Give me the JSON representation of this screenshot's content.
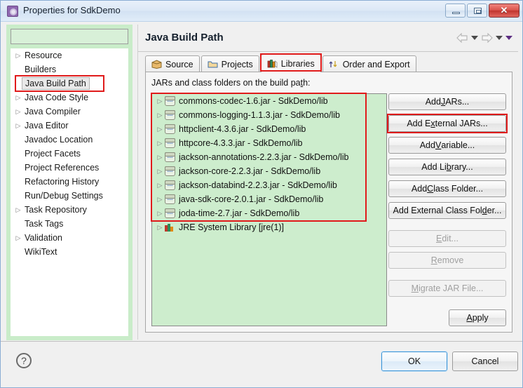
{
  "window": {
    "title": "Properties for SdkDemo",
    "icon": "properties-gear-icon",
    "controls": {
      "minimize": "–",
      "restore": "❐",
      "close": "✕"
    }
  },
  "sidebar": {
    "filter": {
      "value": "",
      "placeholder": ""
    },
    "items": [
      {
        "label": "Resource",
        "expandable": true,
        "selected": false
      },
      {
        "label": "Builders",
        "expandable": false,
        "selected": false
      },
      {
        "label": "Java Build Path",
        "expandable": false,
        "selected": true
      },
      {
        "label": "Java Code Style",
        "expandable": true,
        "selected": false
      },
      {
        "label": "Java Compiler",
        "expandable": true,
        "selected": false
      },
      {
        "label": "Java Editor",
        "expandable": true,
        "selected": false
      },
      {
        "label": "Javadoc Location",
        "expandable": false,
        "selected": false
      },
      {
        "label": "Project Facets",
        "expandable": false,
        "selected": false
      },
      {
        "label": "Project References",
        "expandable": false,
        "selected": false
      },
      {
        "label": "Refactoring History",
        "expandable": false,
        "selected": false
      },
      {
        "label": "Run/Debug Settings",
        "expandable": false,
        "selected": false
      },
      {
        "label": "Task Repository",
        "expandable": true,
        "selected": false
      },
      {
        "label": "Task Tags",
        "expandable": false,
        "selected": false
      },
      {
        "label": "Validation",
        "expandable": true,
        "selected": false
      },
      {
        "label": "WikiText",
        "expandable": false,
        "selected": false
      }
    ]
  },
  "main": {
    "page_title": "Java Build Path",
    "nav": {
      "back_icon": "back-arrow-icon",
      "back_dropdown_icon": "chevron-down-icon",
      "forward_icon": "forward-arrow-icon",
      "forward_dropdown_icon": "chevron-down-icon",
      "menu_dropdown_icon": "chevron-down-purple-icon"
    },
    "tabs": [
      {
        "label": "Source",
        "icon": "package-icon",
        "active": false
      },
      {
        "label": "Projects",
        "icon": "folder-icon",
        "active": false
      },
      {
        "label": "Libraries",
        "icon": "books-icon",
        "active": true,
        "highlighted": true
      },
      {
        "label": "Order and Export",
        "icon": "order-arrows-icon",
        "active": false
      }
    ],
    "hint_prefix": "JARs and class folders on the build pa",
    "hint_mnemonic": "t",
    "hint_suffix": "h:",
    "jars": [
      {
        "name": "commons-codec-1.6.jar - SdkDemo/lib",
        "icon": "jar-icon"
      },
      {
        "name": "commons-logging-1.1.3.jar - SdkDemo/lib",
        "icon": "jar-icon"
      },
      {
        "name": "httpclient-4.3.6.jar - SdkDemo/lib",
        "icon": "jar-icon"
      },
      {
        "name": "httpcore-4.3.3.jar - SdkDemo/lib",
        "icon": "jar-icon"
      },
      {
        "name": "jackson-annotations-2.2.3.jar - SdkDemo/lib",
        "icon": "jar-icon"
      },
      {
        "name": "jackson-core-2.2.3.jar - SdkDemo/lib",
        "icon": "jar-icon"
      },
      {
        "name": "jackson-databind-2.2.3.jar - SdkDemo/lib",
        "icon": "jar-icon"
      },
      {
        "name": "java-sdk-core-2.0.1.jar - SdkDemo/lib",
        "icon": "jar-icon"
      },
      {
        "name": "joda-time-2.7.jar - SdkDemo/lib",
        "icon": "jar-icon"
      }
    ],
    "jre_entry": {
      "name": "JRE System Library [jre(1)]",
      "icon": "library-icon"
    },
    "buttons": [
      {
        "label_pre": "Add ",
        "mnemonic": "J",
        "label_post": "ARs...",
        "disabled": false,
        "highlighted": false,
        "name": "add-jars-button"
      },
      {
        "label_pre": "Add E",
        "mnemonic": "x",
        "label_post": "ternal JARs...",
        "disabled": false,
        "highlighted": true,
        "name": "add-external-jars-button"
      },
      {
        "label_pre": "Add ",
        "mnemonic": "V",
        "label_post": "ariable...",
        "disabled": false,
        "highlighted": false,
        "name": "add-variable-button"
      },
      {
        "label_pre": "Add Li",
        "mnemonic": "b",
        "label_post": "rary...",
        "disabled": false,
        "highlighted": false,
        "name": "add-library-button"
      },
      {
        "label_pre": "Add ",
        "mnemonic": "C",
        "label_post": "lass Folder...",
        "disabled": false,
        "highlighted": false,
        "name": "add-class-folder-button"
      },
      {
        "label_pre": "Add External Class Fol",
        "mnemonic": "d",
        "label_post": "er...",
        "disabled": false,
        "highlighted": false,
        "name": "add-external-class-folder-button"
      },
      {
        "label_pre": "",
        "mnemonic": "E",
        "label_post": "dit...",
        "disabled": true,
        "highlighted": false,
        "name": "edit-button"
      },
      {
        "label_pre": "",
        "mnemonic": "R",
        "label_post": "emove",
        "disabled": true,
        "highlighted": false,
        "name": "remove-button"
      },
      {
        "label_pre": "",
        "mnemonic": "M",
        "label_post": "igrate JAR File...",
        "disabled": true,
        "highlighted": false,
        "name": "migrate-jar-file-button"
      }
    ],
    "apply": {
      "mnemonic": "A",
      "label_post": "pply"
    }
  },
  "footer": {
    "help_icon": "help-question-icon",
    "ok_label": "OK",
    "cancel_label": "Cancel"
  }
}
